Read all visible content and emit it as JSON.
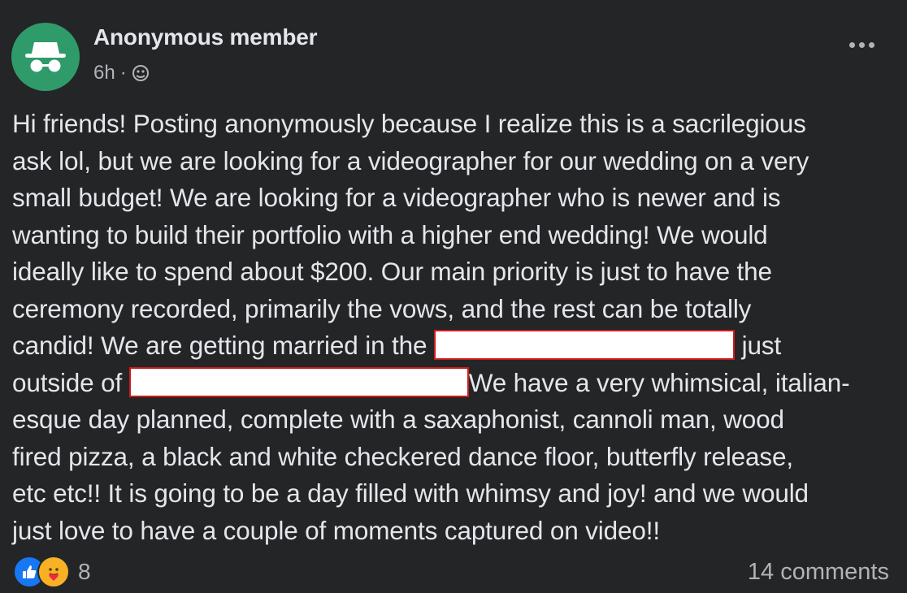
{
  "post": {
    "author": "Anonymous member",
    "time": "6h",
    "separator": "·",
    "audience_icon": "group-icon",
    "body": {
      "line1": "Hi friends! Posting anonymously because I realize this is a sacrilegious",
      "line2": "ask lol, but we are looking for a videographer for our wedding on a very",
      "line3": "small budget! We are looking for a videographer who is newer and is",
      "line4": "wanting to build their portfolio with a higher end wedding! We would",
      "line5": "ideally like to spend about $200. Our main priority is just to have the",
      "line6": "ceremony recorded, primarily the vows, and the rest can be totally",
      "line7_a": "candid! We are getting married in the ",
      "line7_b": "just",
      "line8_a": "outside of ",
      "line8_b": "We have a very whimsical, italian-",
      "line9": "esque day planned, complete with a saxaphonist, cannoli man, wood",
      "line10": "fired pizza, a black and white checkered dance floor, butterfly release,",
      "line11": "etc etc!! It is going to be a day filled with whimsy and joy! and we would",
      "line12": "just love to have a couple of moments captured on video!!"
    },
    "reactions": {
      "icons": [
        "like-icon",
        "care-icon"
      ],
      "count": "8"
    },
    "comments": "14 comments"
  },
  "colors": {
    "background": "#242526",
    "text": "#e4e6eb",
    "secondary_text": "#b0b3b8",
    "avatar": "#2f9b6b",
    "like": "#1877f2",
    "care": "#f7b125",
    "redaction_border": "#d01a1a"
  }
}
